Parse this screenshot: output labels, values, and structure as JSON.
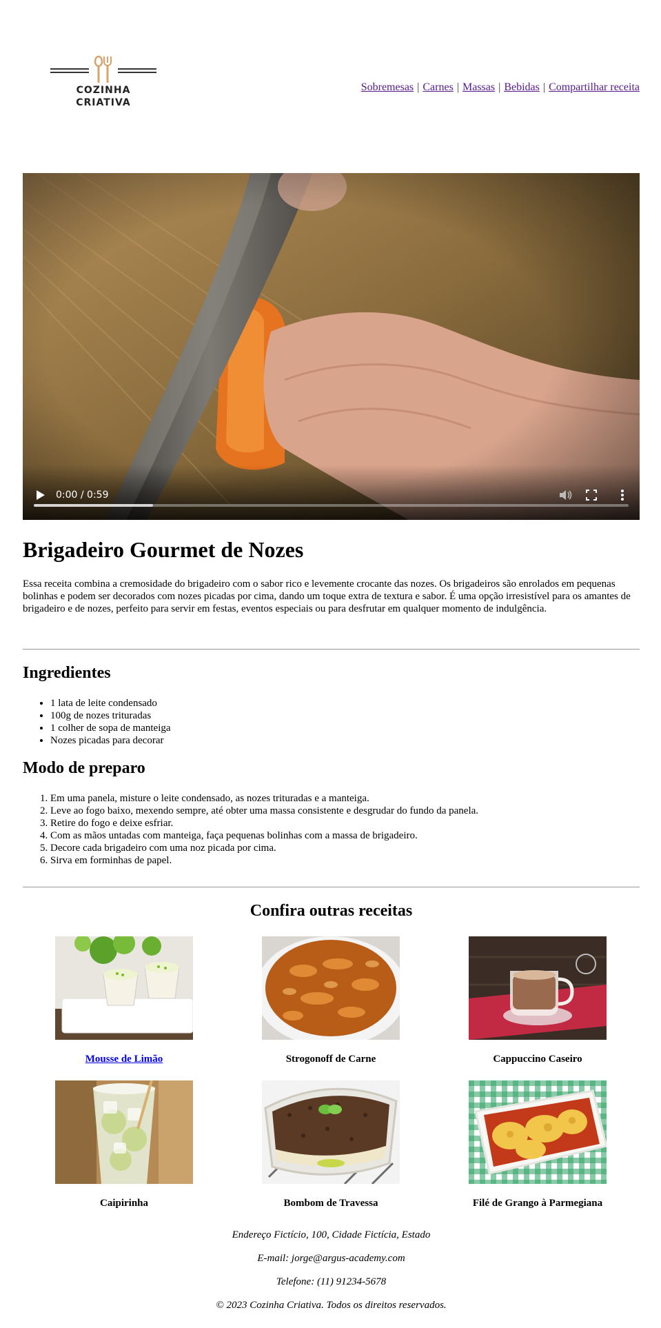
{
  "brand": {
    "line1": "COZINHA",
    "line2": "CRIATIVA",
    "logo_icon": "spoon-fork-icon",
    "accent": "#d8a36a"
  },
  "nav": {
    "items": [
      "Sobremesas",
      "Carnes",
      "Massas",
      "Bebidas",
      "Compartilhar receita"
    ],
    "separator": "|"
  },
  "video": {
    "time": "0:00 / 0:59",
    "progress_fraction": 0.2,
    "controls": [
      "play-icon",
      "mute-icon",
      "fullscreen-icon",
      "more-options-icon"
    ]
  },
  "recipe": {
    "title": "Brigadeiro Gourmet de Nozes",
    "intro": "Essa receita combina a cremosidade do brigadeiro com o sabor rico e levemente crocante das nozes. Os brigadeiros são enrolados em pequenas bolinhas e podem ser decorados com nozes picadas por cima, dando um toque extra de textura e sabor. É uma opção irresistível para os amantes de brigadeiro e de nozes, perfeito para servir em festas, eventos especiais ou para desfrutar em qualquer momento de indulgência.",
    "ingredients_title": "Ingredientes",
    "ingredients": [
      "1 lata de leite condensado",
      "100g de nozes trituradas",
      "1 colher de sopa de manteiga",
      "Nozes picadas para decorar"
    ],
    "steps_title": "Modo de preparo",
    "steps": [
      "Em uma panela, misture o leite condensado, as nozes trituradas e a manteiga.",
      "Leve ao fogo baixo, mexendo sempre, até obter uma massa consistente e desgrudar do fundo da panela.",
      "Retire do fogo e deixe esfriar.",
      "Com as mãos untadas com manteiga, faça pequenas bolinhas com a massa de brigadeiro.",
      "Decore cada brigadeiro com uma noz picada por cima.",
      "Sirva em forminhas de papel."
    ]
  },
  "more": {
    "title": "Confira outras receitas",
    "items": [
      {
        "name": "Mousse de Limão",
        "link": true
      },
      {
        "name": "Strogonoff de Carne",
        "link": false
      },
      {
        "name": "Cappuccino Caseiro",
        "link": false
      },
      {
        "name": "Caipirinha",
        "link": false
      },
      {
        "name": "Bombom de Travessa",
        "link": false
      },
      {
        "name": "Filé de Grango à Parmegiana",
        "link": false
      }
    ]
  },
  "footer": {
    "address": "Endereço Fictício, 100, Cidade Fictícia, Estado",
    "email": "E-mail: jorge@argus-academy.com",
    "phone": "Telefone: (11) 91234-5678",
    "copyright": "© 2023 Cozinha Criativa. Todos os direitos reservados."
  }
}
